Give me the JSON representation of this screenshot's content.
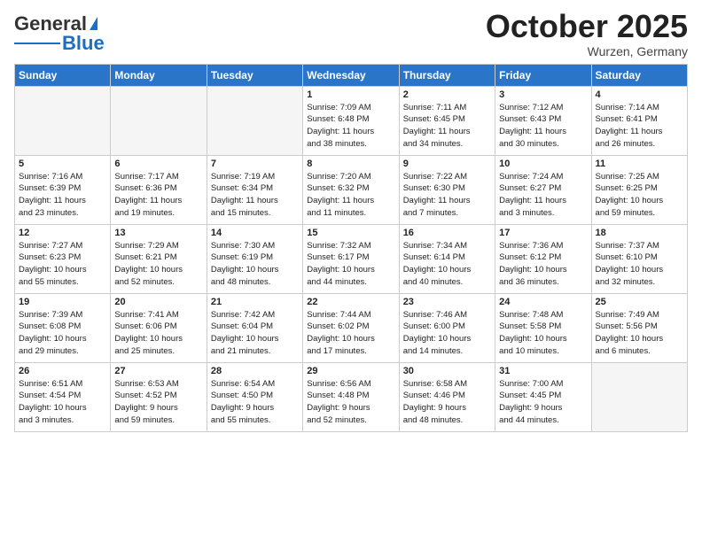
{
  "header": {
    "logo_general": "General",
    "logo_blue": "Blue",
    "month": "October 2025",
    "location": "Wurzen, Germany"
  },
  "weekdays": [
    "Sunday",
    "Monday",
    "Tuesday",
    "Wednesday",
    "Thursday",
    "Friday",
    "Saturday"
  ],
  "weeks": [
    [
      {
        "day": "",
        "content": ""
      },
      {
        "day": "",
        "content": ""
      },
      {
        "day": "",
        "content": ""
      },
      {
        "day": "1",
        "content": "Sunrise: 7:09 AM\nSunset: 6:48 PM\nDaylight: 11 hours\nand 38 minutes."
      },
      {
        "day": "2",
        "content": "Sunrise: 7:11 AM\nSunset: 6:45 PM\nDaylight: 11 hours\nand 34 minutes."
      },
      {
        "day": "3",
        "content": "Sunrise: 7:12 AM\nSunset: 6:43 PM\nDaylight: 11 hours\nand 30 minutes."
      },
      {
        "day": "4",
        "content": "Sunrise: 7:14 AM\nSunset: 6:41 PM\nDaylight: 11 hours\nand 26 minutes."
      }
    ],
    [
      {
        "day": "5",
        "content": "Sunrise: 7:16 AM\nSunset: 6:39 PM\nDaylight: 11 hours\nand 23 minutes."
      },
      {
        "day": "6",
        "content": "Sunrise: 7:17 AM\nSunset: 6:36 PM\nDaylight: 11 hours\nand 19 minutes."
      },
      {
        "day": "7",
        "content": "Sunrise: 7:19 AM\nSunset: 6:34 PM\nDaylight: 11 hours\nand 15 minutes."
      },
      {
        "day": "8",
        "content": "Sunrise: 7:20 AM\nSunset: 6:32 PM\nDaylight: 11 hours\nand 11 minutes."
      },
      {
        "day": "9",
        "content": "Sunrise: 7:22 AM\nSunset: 6:30 PM\nDaylight: 11 hours\nand 7 minutes."
      },
      {
        "day": "10",
        "content": "Sunrise: 7:24 AM\nSunset: 6:27 PM\nDaylight: 11 hours\nand 3 minutes."
      },
      {
        "day": "11",
        "content": "Sunrise: 7:25 AM\nSunset: 6:25 PM\nDaylight: 10 hours\nand 59 minutes."
      }
    ],
    [
      {
        "day": "12",
        "content": "Sunrise: 7:27 AM\nSunset: 6:23 PM\nDaylight: 10 hours\nand 55 minutes."
      },
      {
        "day": "13",
        "content": "Sunrise: 7:29 AM\nSunset: 6:21 PM\nDaylight: 10 hours\nand 52 minutes."
      },
      {
        "day": "14",
        "content": "Sunrise: 7:30 AM\nSunset: 6:19 PM\nDaylight: 10 hours\nand 48 minutes."
      },
      {
        "day": "15",
        "content": "Sunrise: 7:32 AM\nSunset: 6:17 PM\nDaylight: 10 hours\nand 44 minutes."
      },
      {
        "day": "16",
        "content": "Sunrise: 7:34 AM\nSunset: 6:14 PM\nDaylight: 10 hours\nand 40 minutes."
      },
      {
        "day": "17",
        "content": "Sunrise: 7:36 AM\nSunset: 6:12 PM\nDaylight: 10 hours\nand 36 minutes."
      },
      {
        "day": "18",
        "content": "Sunrise: 7:37 AM\nSunset: 6:10 PM\nDaylight: 10 hours\nand 32 minutes."
      }
    ],
    [
      {
        "day": "19",
        "content": "Sunrise: 7:39 AM\nSunset: 6:08 PM\nDaylight: 10 hours\nand 29 minutes."
      },
      {
        "day": "20",
        "content": "Sunrise: 7:41 AM\nSunset: 6:06 PM\nDaylight: 10 hours\nand 25 minutes."
      },
      {
        "day": "21",
        "content": "Sunrise: 7:42 AM\nSunset: 6:04 PM\nDaylight: 10 hours\nand 21 minutes."
      },
      {
        "day": "22",
        "content": "Sunrise: 7:44 AM\nSunset: 6:02 PM\nDaylight: 10 hours\nand 17 minutes."
      },
      {
        "day": "23",
        "content": "Sunrise: 7:46 AM\nSunset: 6:00 PM\nDaylight: 10 hours\nand 14 minutes."
      },
      {
        "day": "24",
        "content": "Sunrise: 7:48 AM\nSunset: 5:58 PM\nDaylight: 10 hours\nand 10 minutes."
      },
      {
        "day": "25",
        "content": "Sunrise: 7:49 AM\nSunset: 5:56 PM\nDaylight: 10 hours\nand 6 minutes."
      }
    ],
    [
      {
        "day": "26",
        "content": "Sunrise: 6:51 AM\nSunset: 4:54 PM\nDaylight: 10 hours\nand 3 minutes."
      },
      {
        "day": "27",
        "content": "Sunrise: 6:53 AM\nSunset: 4:52 PM\nDaylight: 9 hours\nand 59 minutes."
      },
      {
        "day": "28",
        "content": "Sunrise: 6:54 AM\nSunset: 4:50 PM\nDaylight: 9 hours\nand 55 minutes."
      },
      {
        "day": "29",
        "content": "Sunrise: 6:56 AM\nSunset: 4:48 PM\nDaylight: 9 hours\nand 52 minutes."
      },
      {
        "day": "30",
        "content": "Sunrise: 6:58 AM\nSunset: 4:46 PM\nDaylight: 9 hours\nand 48 minutes."
      },
      {
        "day": "31",
        "content": "Sunrise: 7:00 AM\nSunset: 4:45 PM\nDaylight: 9 hours\nand 44 minutes."
      },
      {
        "day": "",
        "content": ""
      }
    ]
  ]
}
